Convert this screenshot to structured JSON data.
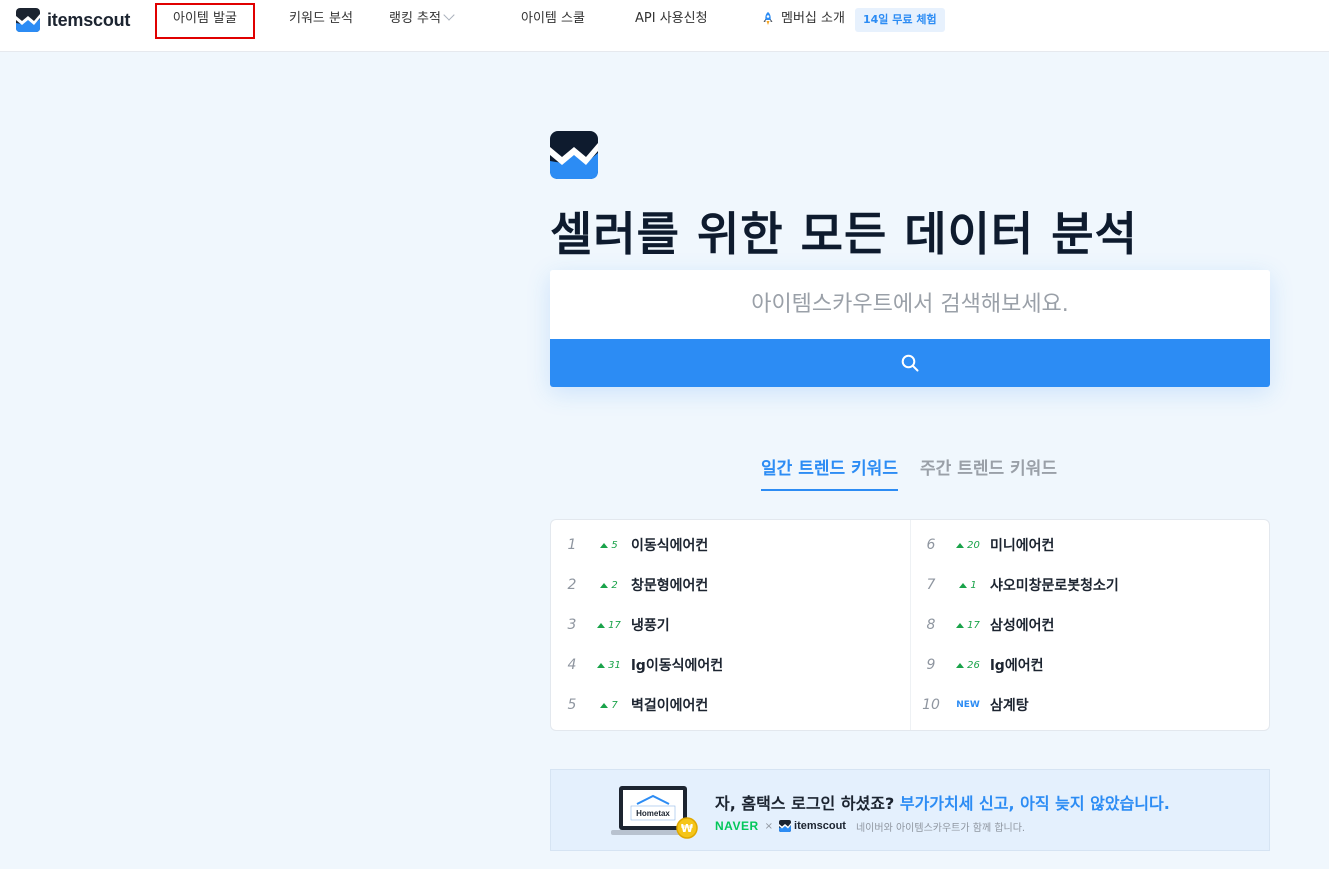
{
  "brand": {
    "name": "itemscout"
  },
  "nav": {
    "items": [
      {
        "label": "아이템 발굴"
      },
      {
        "label": "키워드 분석"
      },
      {
        "label": "랭킹 추적"
      },
      {
        "label": "아이템 스쿨"
      },
      {
        "label": "API 사용신청"
      },
      {
        "label": "멤버십 소개"
      }
    ],
    "trial_badge": "14일 무료 체험"
  },
  "hero": {
    "title": "셀러를 위한 모든 데이터 분석"
  },
  "search": {
    "placeholder": "아이템스카우트에서 검색해보세요."
  },
  "tabs": [
    {
      "label": "일간 트렌드 키워드"
    },
    {
      "label": "주간 트렌드 키워드"
    }
  ],
  "keywords": [
    {
      "rank": "1",
      "change": "5",
      "name": "이동식에어컨"
    },
    {
      "rank": "2",
      "change": "2",
      "name": "창문형에어컨"
    },
    {
      "rank": "3",
      "change": "17",
      "name": "냉풍기"
    },
    {
      "rank": "4",
      "change": "31",
      "name": "lg이동식에어컨"
    },
    {
      "rank": "5",
      "change": "7",
      "name": "벽걸이에어컨"
    },
    {
      "rank": "6",
      "change": "20",
      "name": "미니에어컨"
    },
    {
      "rank": "7",
      "change": "1",
      "name": "샤오미창문로봇청소기"
    },
    {
      "rank": "8",
      "change": "17",
      "name": "삼성에어컨"
    },
    {
      "rank": "9",
      "change": "26",
      "name": "lg에어컨"
    },
    {
      "rank": "10",
      "change": "NEW",
      "name": "삼계탕"
    }
  ],
  "banner": {
    "headline_main": "자, 홈택스 로그인 하셨죠? ",
    "headline_accent": "부가가치세 신고, 아직 늦지 않았습니다.",
    "naver": "NAVER",
    "times": "×",
    "partner": "itemscout",
    "note": "네이버와 아이템스카우트가 함께 합니다.",
    "art_text": "Hometax"
  },
  "colors": {
    "accent": "#2c8cf4",
    "up": "#1aa34a",
    "highlight_box": "#e00000"
  }
}
